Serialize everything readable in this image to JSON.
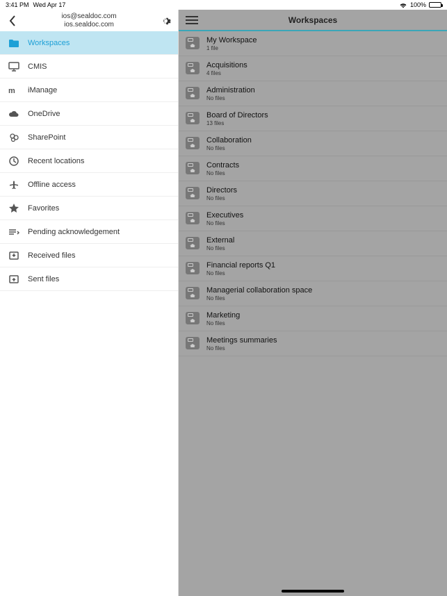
{
  "status": {
    "time": "3:41 PM",
    "date": "Wed Apr 17",
    "battery_pct": "100%"
  },
  "sidebar": {
    "header_line1": "ios@sealdoc.com",
    "header_line2": "ios.sealdoc.com",
    "items": [
      {
        "label": "Workspaces",
        "icon": "folder-icon",
        "active": true
      },
      {
        "label": "CMIS",
        "icon": "monitor-icon",
        "active": false
      },
      {
        "label": "iManage",
        "icon": "imanage-icon",
        "active": false
      },
      {
        "label": "OneDrive",
        "icon": "cloud-icon",
        "active": false
      },
      {
        "label": "SharePoint",
        "icon": "sharepoint-icon",
        "active": false
      },
      {
        "label": "Recent locations",
        "icon": "clock-icon",
        "active": false
      },
      {
        "label": "Offline access",
        "icon": "airplane-icon",
        "active": false
      },
      {
        "label": "Favorites",
        "icon": "star-icon",
        "active": false
      },
      {
        "label": "Pending acknowledgement",
        "icon": "pending-icon",
        "active": false
      },
      {
        "label": "Received files",
        "icon": "inbox-icon",
        "active": false
      },
      {
        "label": "Sent files",
        "icon": "outbox-icon",
        "active": false
      }
    ]
  },
  "main": {
    "title": "Workspaces",
    "items": [
      {
        "title": "My Workspace",
        "sub": "1 file"
      },
      {
        "title": "Acquisitions",
        "sub": "4 files"
      },
      {
        "title": "Administration",
        "sub": "No files"
      },
      {
        "title": "Board of Directors",
        "sub": "13 files"
      },
      {
        "title": "Collaboration",
        "sub": "No files"
      },
      {
        "title": "Contracts",
        "sub": "No files"
      },
      {
        "title": "Directors",
        "sub": "No files"
      },
      {
        "title": "Executives",
        "sub": "No files"
      },
      {
        "title": "External",
        "sub": "No files"
      },
      {
        "title": "Financial reports Q1",
        "sub": "No files"
      },
      {
        "title": "Managerial collaboration space",
        "sub": "No files"
      },
      {
        "title": "Marketing",
        "sub": "No files"
      },
      {
        "title": "Meetings summaries",
        "sub": "No files"
      }
    ]
  }
}
